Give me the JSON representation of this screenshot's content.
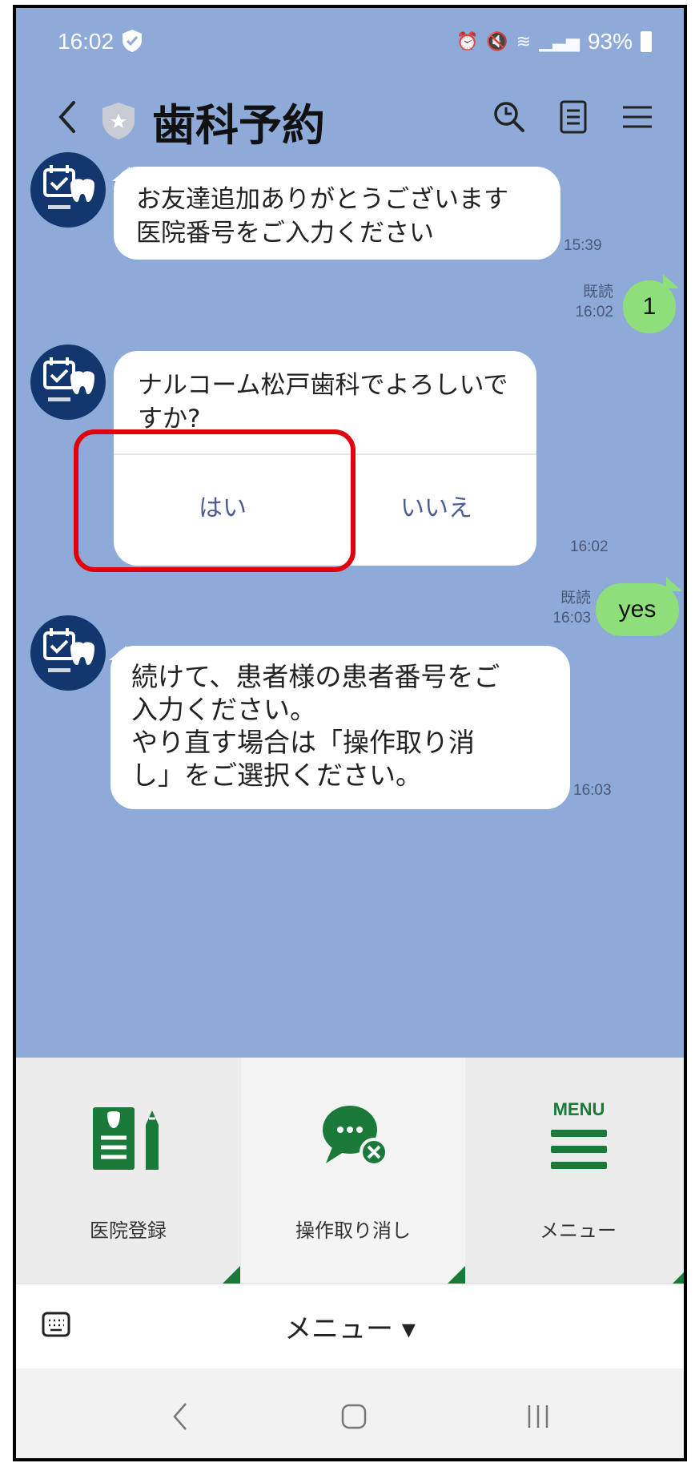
{
  "status_bar": {
    "time": "16:02",
    "battery_percent": "93%",
    "right_icons": [
      "alarm-icon",
      "mute-icon",
      "wifi-icon",
      "signal-icon",
      "battery-icon"
    ]
  },
  "header": {
    "title": "歯科予約"
  },
  "messages": [
    {
      "sender": "bot",
      "lines": [
        "お友達追加ありがとうございます",
        "医院番号をご入力ください"
      ],
      "time": "15:39"
    },
    {
      "sender": "user",
      "text": "1",
      "read_label": "既読",
      "time": "16:02"
    },
    {
      "sender": "bot",
      "type": "confirm",
      "lines": [
        "ナルコーム松戸歯科でよろしいで",
        "すか?"
      ],
      "options": [
        "はい",
        "いいえ"
      ],
      "time": "16:02"
    },
    {
      "sender": "user",
      "text": "yes",
      "read_label": "既読",
      "time": "16:03"
    },
    {
      "sender": "bot",
      "lines": [
        "続けて、患者様の患者番号をご",
        "入力ください。",
        "やり直す場合は「操作取り消",
        "し」をご選択ください。"
      ],
      "time": "16:03"
    }
  ],
  "rich_menu": {
    "items": [
      {
        "label": "医院登録",
        "icon": "clinic-register-icon"
      },
      {
        "label": "操作取り消し",
        "icon": "cancel-chat-icon"
      },
      {
        "label": "メニュー",
        "icon": "menu-lines-icon",
        "icon_text": "MENU"
      }
    ]
  },
  "bottom_bar": {
    "menu_toggle": "メニュー ▾"
  },
  "colors": {
    "chat_background": "#8eaad8",
    "user_bubble": "#8fde7c",
    "accent_green": "#1a7a3a",
    "highlight_red": "#e0000d",
    "avatar_navy": "#12366e"
  }
}
